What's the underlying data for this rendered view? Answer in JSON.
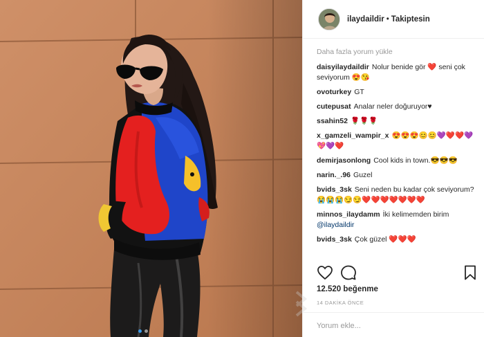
{
  "post": {
    "username": "ilaydaildir",
    "separator": "•",
    "follow_status": "Takiptesin"
  },
  "comments_panel": {
    "load_more": "Daha fazla yorum yükle",
    "comments": [
      {
        "user": "daisyilaydaildir",
        "text": "Nolur benide gör ❤️ seni çok seviyorum 😍😘"
      },
      {
        "user": "ovoturkey",
        "text": "GT"
      },
      {
        "user": "cutepusat",
        "text": "Analar neler doğuruyor♥"
      },
      {
        "user": "ssahin52",
        "text": "🌹🌹🌹"
      },
      {
        "user": "x_gamzeli_wampir_x",
        "text": "😍😍😍😊😊💜❤️❤️💜💖💜❤️"
      },
      {
        "user": "demirjasonlong",
        "text": "Cool kids in town.😎😎😎"
      },
      {
        "user": "narin._.96",
        "text": "Guzel"
      },
      {
        "user": "bvids_3sk",
        "text": "Seni neden bu kadar çok seviyorum? 😭😭😭😏😏❤️❤️❤️❤️❤️❤️❤️"
      },
      {
        "user": "minnos_ilaydamm",
        "text": "İki kelimemden birim",
        "mention": "@ilaydaildir"
      },
      {
        "user": "bvids_3sk",
        "text": "Çok güzel ❤️❤️❤️"
      }
    ]
  },
  "actions": {
    "like_icon": "heart-icon",
    "comment_icon": "comment-icon",
    "save_icon": "bookmark-icon"
  },
  "likes": "12.520 beğenme",
  "timestamp": "14 DAKİKA ÖNCE",
  "add_comment": {
    "placeholder": "Yorum ekle..."
  },
  "colors": {
    "wall": "#c98962",
    "mention": "#003569",
    "muted": "#999999",
    "jacket_red": "#e4201f",
    "jacket_blue": "#1f45c9"
  }
}
